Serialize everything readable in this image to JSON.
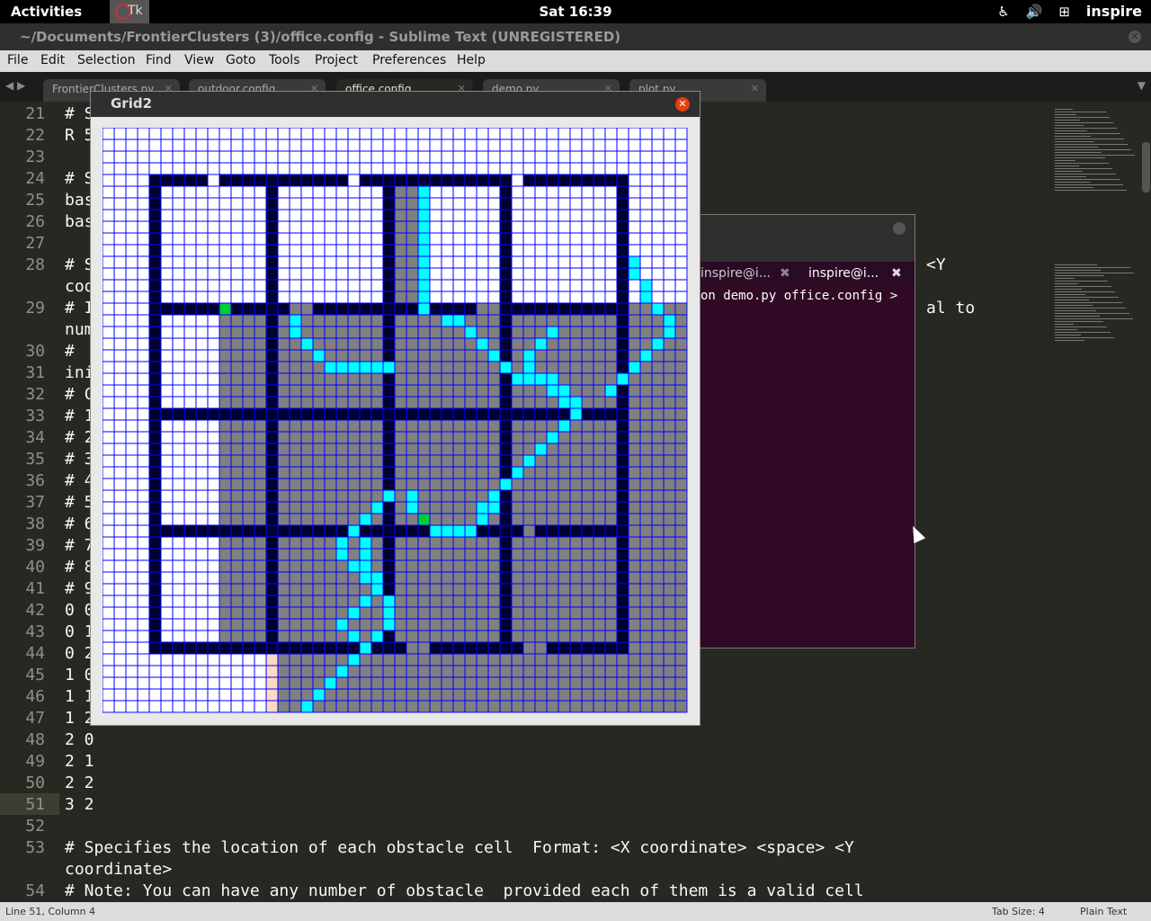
{
  "topbar": {
    "activities": "Activities",
    "tk_app": "Tk",
    "clock": "Sat 16:39",
    "user": "inspire"
  },
  "window_title": "~/Documents/FrontierClusters (3)/office.config - Sublime Text (UNREGISTERED)",
  "menu": [
    "File",
    "Edit",
    "Selection",
    "Find",
    "View",
    "Goto",
    "Tools",
    "Project",
    "Preferences",
    "Help"
  ],
  "tabs": [
    "FrontierClusters.py",
    "outdoor.config",
    "office.config",
    "demo.py",
    "plot.py"
  ],
  "editor": {
    "lines": [
      {
        "n": "21",
        "t": "# S"
      },
      {
        "n": "22",
        "t": "R 5"
      },
      {
        "n": "23",
        "t": ""
      },
      {
        "n": "24",
        "t": "# S"
      },
      {
        "n": "25",
        "t": "bas"
      },
      {
        "n": "26",
        "t": "bas"
      },
      {
        "n": "27",
        "t": ""
      },
      {
        "n": "28",
        "t": "# S"
      },
      {
        "n": "",
        "t": "coo"
      },
      {
        "n": "29",
        "t": "# I"
      },
      {
        "n": "",
        "t": "num"
      },
      {
        "n": "30",
        "t": "# "
      },
      {
        "n": "31",
        "t": "ini"
      },
      {
        "n": "32",
        "t": "# C"
      },
      {
        "n": "33",
        "t": "# 1"
      },
      {
        "n": "34",
        "t": "# 2"
      },
      {
        "n": "35",
        "t": "# 3"
      },
      {
        "n": "36",
        "t": "# 4"
      },
      {
        "n": "37",
        "t": "# 5"
      },
      {
        "n": "38",
        "t": "# 6"
      },
      {
        "n": "39",
        "t": "# 7"
      },
      {
        "n": "40",
        "t": "# 8"
      },
      {
        "n": "41",
        "t": "# 9"
      },
      {
        "n": "42",
        "t": "0 0"
      },
      {
        "n": "43",
        "t": "0 1"
      },
      {
        "n": "44",
        "t": "0 2"
      },
      {
        "n": "45",
        "t": "1 0"
      },
      {
        "n": "46",
        "t": "1 1"
      },
      {
        "n": "47",
        "t": "1 2"
      },
      {
        "n": "48",
        "t": "2 0"
      },
      {
        "n": "49",
        "t": "2 1"
      },
      {
        "n": "50",
        "t": "2 2"
      },
      {
        "n": "51",
        "t": "3 2"
      },
      {
        "n": "52",
        "t": ""
      },
      {
        "n": "53",
        "t": "# Specifies the location of each obstacle cell  Format: <X coordinate> <space> <Y"
      },
      {
        "n": "",
        "t": "coordinate>"
      },
      {
        "n": "54",
        "t": "# Note: You can have any number of obstacle  provided each of them is a valid cell"
      }
    ],
    "line28_tail": "<Y",
    "line29_tail": "al to"
  },
  "terminal": {
    "tab1": "inspire@i...",
    "tab2": "inspire@i...",
    "command": "on demo.py office.config >"
  },
  "grid_window": {
    "title": "Grid2"
  },
  "grid": {
    "colors": {
      "free": "#ffffff",
      "wall": "#000033",
      "explored": "#808080",
      "path": "#00ffff",
      "robot": "#00cc33",
      "frontier": "#ffd8c8",
      "gridline": "#0000ff"
    },
    "cols": 50,
    "rows": 50
  },
  "statusbar": {
    "position": "Line 51, Column 4",
    "tab_size": "Tab Size: 4",
    "syntax": "Plain Text"
  }
}
